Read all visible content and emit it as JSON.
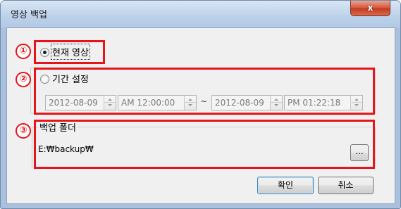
{
  "window": {
    "title": "영상 백업",
    "close_label": "x"
  },
  "markers": [
    "①",
    "②",
    "③"
  ],
  "option_current": {
    "label": "현재 영상",
    "selected": true
  },
  "option_period": {
    "label": "기간 설정",
    "selected": false,
    "start_date": "2012-08-09",
    "start_time": "AM 12:00:00",
    "separator": "~",
    "end_date": "2012-08-09",
    "end_time": "PM 01:22:18"
  },
  "backup_folder": {
    "legend": "백업 폴더",
    "path": "E:₩backup₩",
    "browse_label": "..."
  },
  "buttons": {
    "ok": "확인",
    "cancel": "취소"
  },
  "colors": {
    "annotation": "#e8141b",
    "close_button": "#c2391d"
  }
}
